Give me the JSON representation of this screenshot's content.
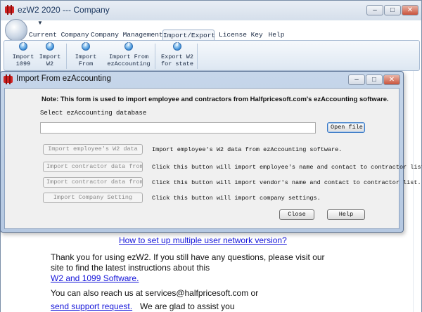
{
  "main_window": {
    "title": "ezW2 2020 --- Company",
    "controls": {
      "minimize": "‒",
      "maximize": "□",
      "close": "✕"
    }
  },
  "tabs": [
    {
      "label": "Current Company",
      "active": false
    },
    {
      "label": "Company Management",
      "active": false
    },
    {
      "label": "Import/Export",
      "active": true
    },
    {
      "label": "License Key",
      "active": false
    },
    {
      "label": "Help",
      "active": false
    }
  ],
  "ribbon": {
    "buttons": [
      {
        "label": "Import\n1099",
        "icon": "import-icon"
      },
      {
        "label": "Import\nW2",
        "icon": "import-icon"
      },
      {
        "label": "Import\nFrom",
        "icon": "import-icon"
      },
      {
        "label": "Import From\nezAccounting",
        "icon": "import-icon"
      },
      {
        "label": "Export W2\nfor state",
        "icon": "export-icon"
      }
    ]
  },
  "content": {
    "network_link": "How to set up multiple user network version?",
    "thanks_line1": "Thank you for using ezW2. If you still have any questions, please visit our",
    "thanks_line2": "site to find the latest instructions about this",
    "software_link": "W2 and 1099 Software.",
    "contact_text": "You can also reach us at services@halfpricesoft.com or",
    "support_link": "send support request.",
    "glad_text": "We are glad to assist you"
  },
  "dialog": {
    "title": "Import From ezAccounting",
    "controls": {
      "minimize": "‒",
      "maximize": "□",
      "close": "✕"
    },
    "note": "Note: This form is used to import employee and contractors from Halfpricesoft.com's ezAccounting software.",
    "db_label": "Select ezAccounting database",
    "db_path": "",
    "open_file_label": "Open file",
    "actions": [
      {
        "button": "Import employee's W2 data",
        "description": "Import employee's W2 data from ezAccounting software."
      },
      {
        "button": "Import contractor data from",
        "description": "Click this button will import employee's name and contact to contractor list."
      },
      {
        "button": "Import contractor data from",
        "description": "Click this button will import vendor's name and contact to contractor list."
      },
      {
        "button": "Import Company Setting",
        "description": "Click this button will import company settings."
      }
    ],
    "close_label": "Close",
    "help_label": "Help"
  }
}
